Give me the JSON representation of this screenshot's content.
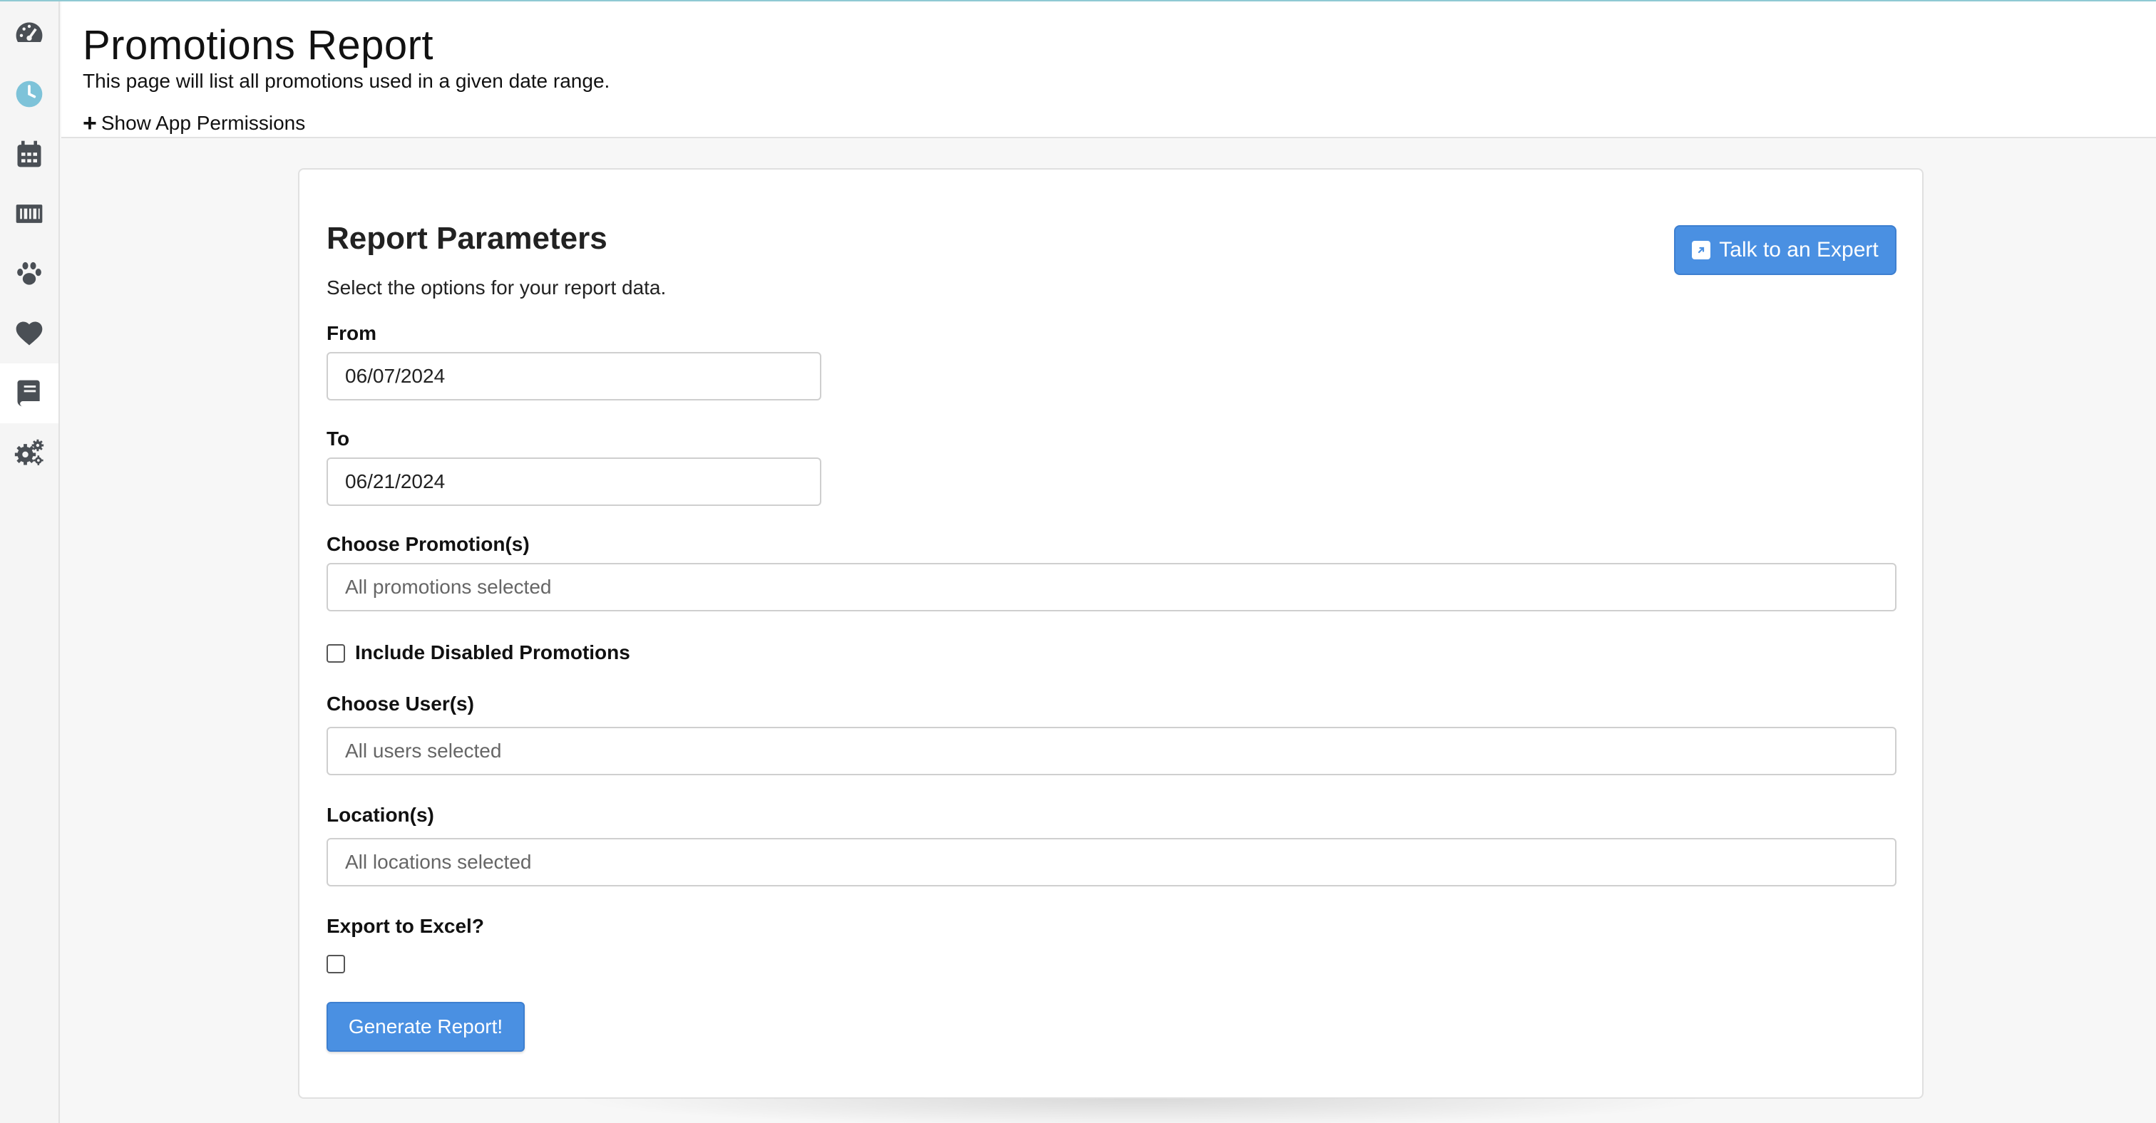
{
  "header": {
    "title": "Promotions Report",
    "subtitle": "This page will list all promotions used in a given date range.",
    "permissions_toggle": "Show App Permissions",
    "permissions_icon": "plus-icon"
  },
  "sidebar": {
    "items": [
      {
        "icon": "dashboard-gauge-icon",
        "active": false
      },
      {
        "icon": "clock-icon",
        "active": false
      },
      {
        "icon": "calendar-icon",
        "active": false
      },
      {
        "icon": "barcode-icon",
        "active": false
      },
      {
        "icon": "paw-icon",
        "active": false
      },
      {
        "icon": "heart-icon",
        "active": false
      },
      {
        "icon": "book-icon",
        "active": true
      },
      {
        "icon": "gears-icon",
        "active": false
      }
    ]
  },
  "report": {
    "title": "Report Parameters",
    "description": "Select the options for your report data.",
    "expert_button": "Talk to an Expert",
    "from_label": "From",
    "from_value": "06/07/2024",
    "to_label": "To",
    "to_value": "06/21/2024",
    "promotions_label": "Choose Promotion(s)",
    "promotions_placeholder": "All promotions selected",
    "include_disabled_label": "Include Disabled Promotions",
    "include_disabled_checked": false,
    "users_label": "Choose User(s)",
    "users_placeholder": "All users selected",
    "locations_label": "Location(s)",
    "locations_placeholder": "All locations selected",
    "export_label": "Export to Excel?",
    "export_checked": false,
    "generate_button": "Generate Report!"
  },
  "colors": {
    "accent": "#4a90e2",
    "sidebar_icon": "#4a4f55",
    "clock_icon": "#7ec3d9",
    "top_line": "#8fc9d3"
  }
}
